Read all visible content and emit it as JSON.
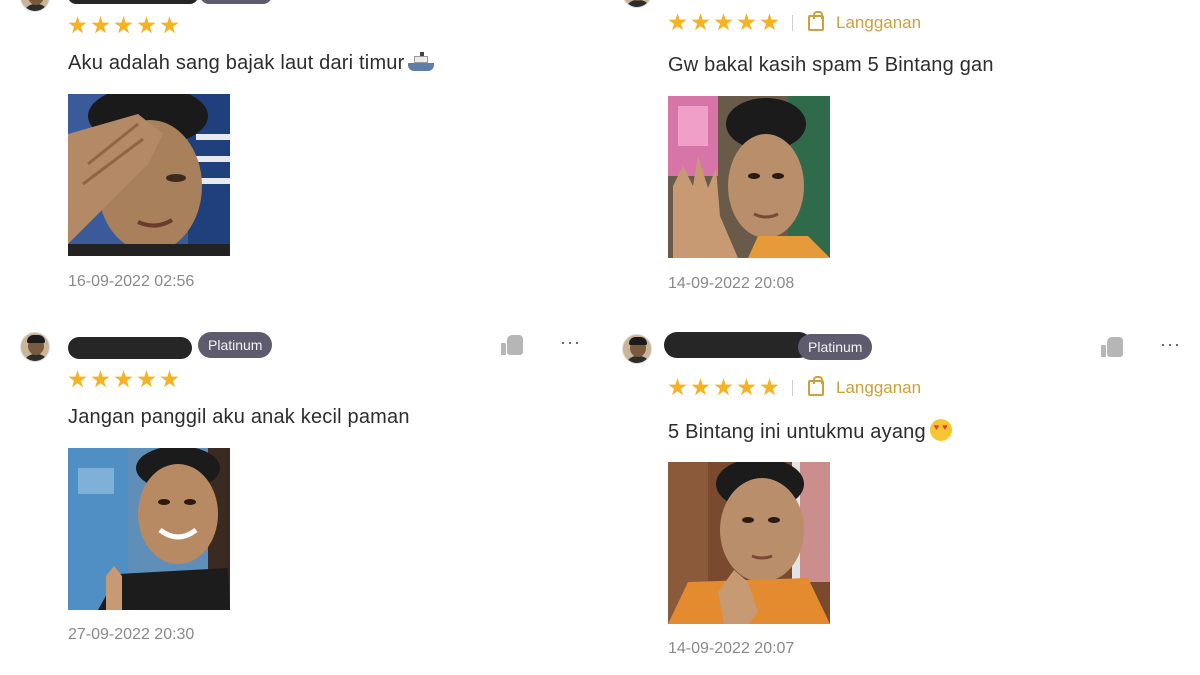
{
  "reviews": [
    {
      "rating": 5,
      "text": "Aku adalah sang bajak laut dari timur",
      "emoji": "ship-emoji",
      "timestamp": "16-09-2022 02:56"
    },
    {
      "rating": 5,
      "subscription_label": "Langganan",
      "text": "Gw bakal kasih spam 5 Bintang gan",
      "timestamp": "14-09-2022 20:08"
    },
    {
      "rating": 5,
      "badge": "Platinum",
      "text": "Jangan panggil aku anak kecil paman",
      "timestamp": "27-09-2022 20:30",
      "more_label": "···"
    },
    {
      "rating": 5,
      "badge": "Platinum",
      "subscription_label": "Langganan",
      "text": "5 Bintang ini untukmu ayang",
      "emoji": "heart-eyes-emoji",
      "timestamp": "14-09-2022 20:07",
      "more_label": "···"
    }
  ],
  "colors": {
    "star": "#f6b321",
    "subscription": "#c9a23c",
    "badge_bg": "#5e5b6e"
  }
}
